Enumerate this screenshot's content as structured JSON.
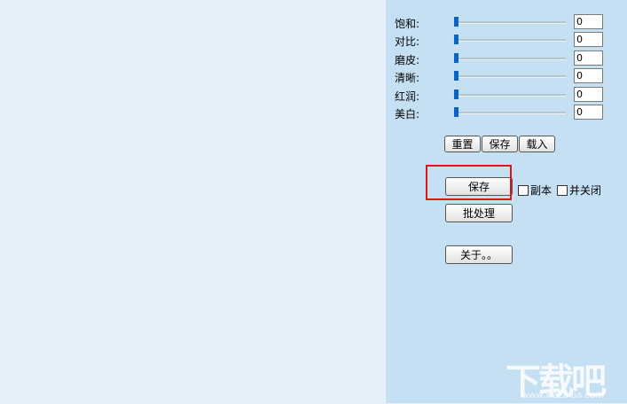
{
  "sliders": [
    {
      "label": "饱和:",
      "value": "0",
      "level": 0
    },
    {
      "label": "对比:",
      "value": "0",
      "level": 0
    },
    {
      "label": "磨皮:",
      "value": "0",
      "level": 0
    },
    {
      "label": "清晰:",
      "value": "0",
      "level": 0
    },
    {
      "label": "红润:",
      "value": "0",
      "level": 0
    },
    {
      "label": "美白:",
      "value": "0",
      "level": 0
    }
  ],
  "preset_buttons": {
    "reset": "重置",
    "save": "保存",
    "load": "载入"
  },
  "actions": {
    "save": "保存",
    "copy_label": "副本",
    "close_label": "并关闭",
    "batch": "批处理",
    "about": "关于。。"
  },
  "watermark": {
    "text": "下载吧",
    "url": "www.xiazaiba.com"
  },
  "colors": {
    "panel": "#c4e0f2",
    "canvas": "#e4f1fa",
    "accent": "#0a63c9",
    "highlight": "#e01414"
  }
}
